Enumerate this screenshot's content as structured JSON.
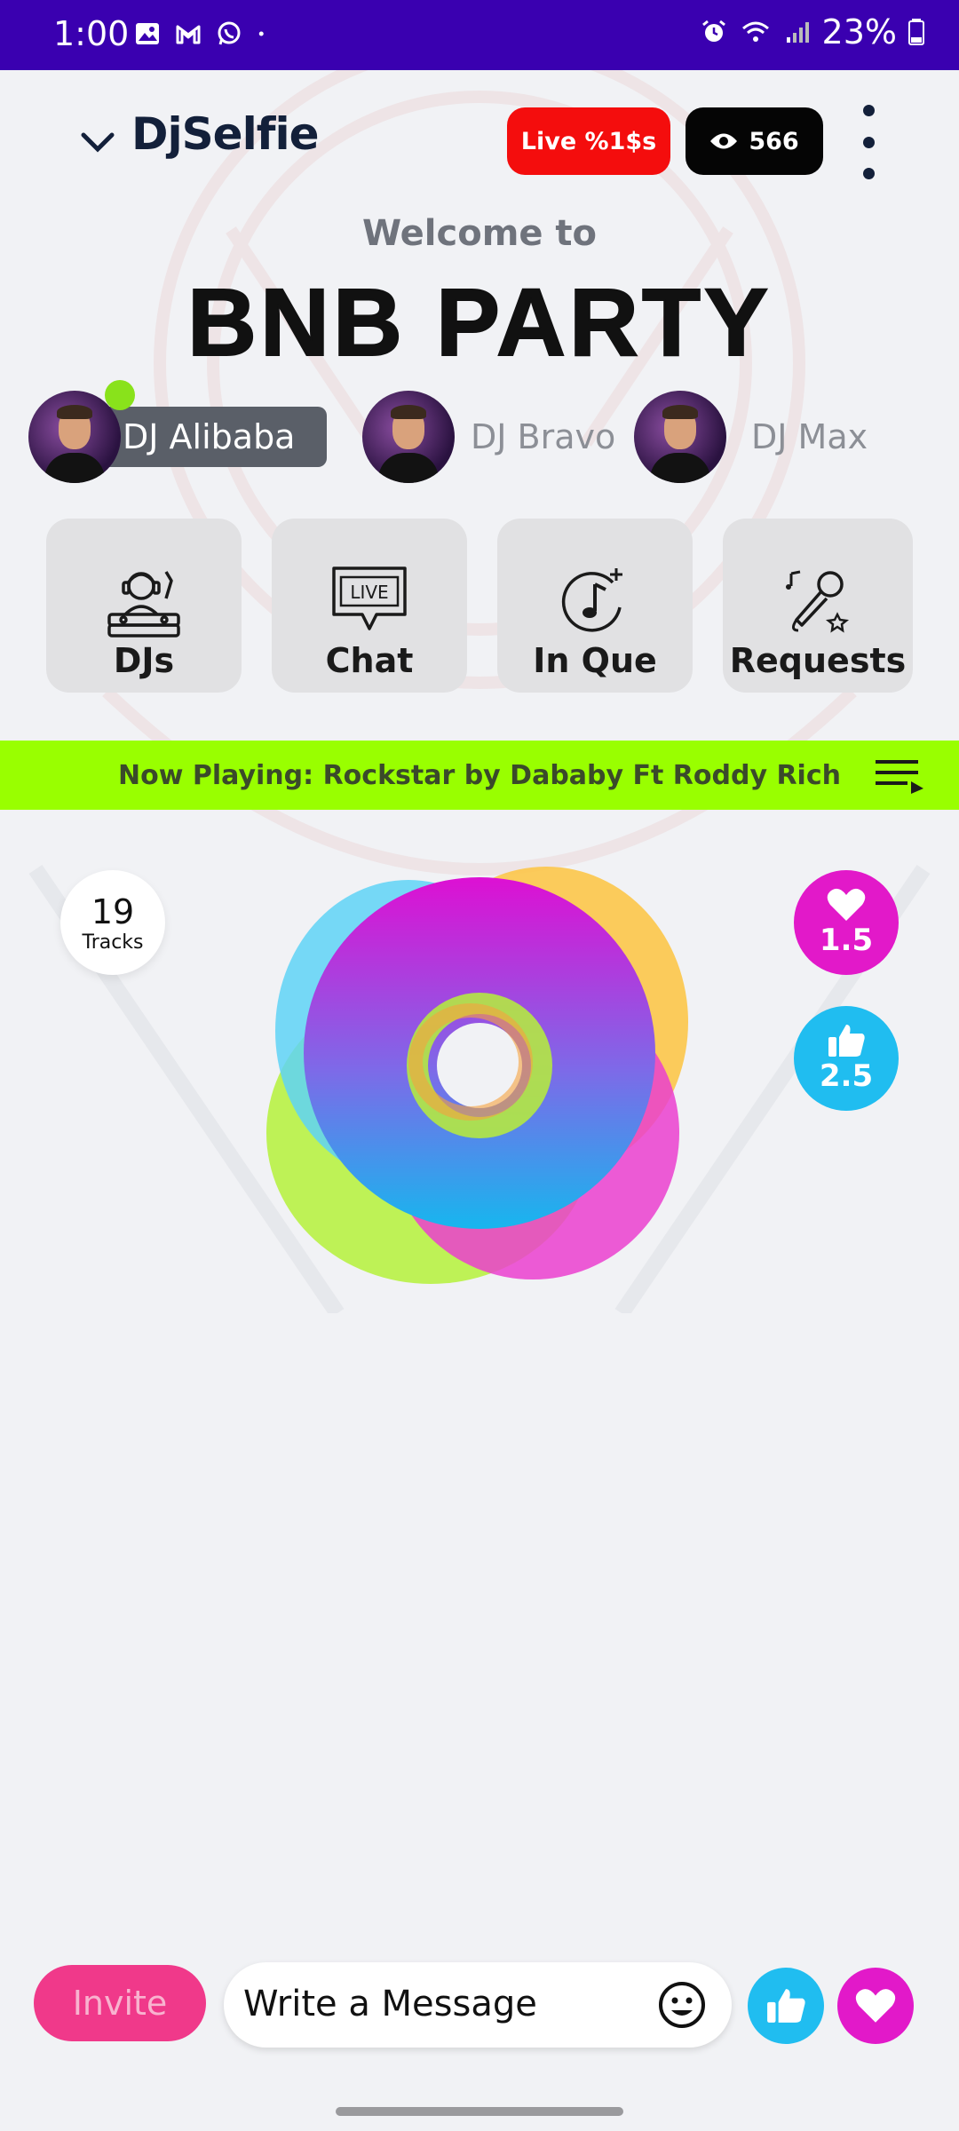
{
  "status_bar": {
    "time": "1:00",
    "battery": "23%",
    "left_icons": [
      "image-icon",
      "gmail-icon",
      "whatsapp-icon",
      "dot-icon"
    ],
    "right_icons": [
      "alarm-icon",
      "wifi-icon",
      "signal-icon",
      "battery-icon"
    ]
  },
  "header": {
    "brand": "DjSelfie",
    "live_label": "Live %1$s",
    "views": "566"
  },
  "welcome_text": "Welcome to",
  "party_title": "BNB PARTY",
  "djs": [
    {
      "name": "DJ Alibaba",
      "active": true
    },
    {
      "name": "DJ Bravo",
      "active": false
    },
    {
      "name": "DJ Max",
      "active": false
    }
  ],
  "tiles": [
    {
      "label": "DJs",
      "icon": "dj-icon"
    },
    {
      "label": "Chat",
      "icon": "live-chat-icon"
    },
    {
      "label": "In Que",
      "icon": "music-add-icon"
    },
    {
      "label": "Requests",
      "icon": "microphone-icon"
    }
  ],
  "now_playing": "Now Playing: Rockstar by Dababy Ft Roddy Rich",
  "tracks": {
    "count": "19",
    "label": "Tracks"
  },
  "stats": {
    "hearts": "1.5",
    "likes": "2.5"
  },
  "composer": {
    "invite_label": "Invite",
    "placeholder": "Write a Message"
  },
  "colors": {
    "status_bar": "#3a00b0",
    "live": "#f40d0d",
    "now_playing_bg": "#99ff00",
    "heart": "#e219c9",
    "like": "#20bdf0",
    "invite": "#f0398a"
  }
}
